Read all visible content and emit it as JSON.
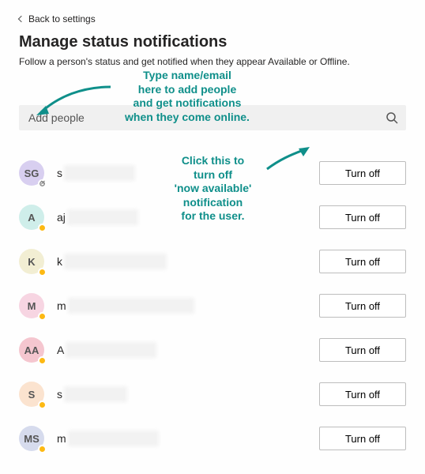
{
  "nav": {
    "back_label": "Back to settings"
  },
  "header": {
    "title": "Manage status notifications",
    "subtitle": "Follow a person's status and get notified when they appear Available or Offline."
  },
  "search": {
    "placeholder": "Add people"
  },
  "button_label": "Turn off",
  "people": [
    {
      "initials": "SG",
      "prefix": "s",
      "presence": "offline",
      "bg": "bg0",
      "redact_w": 90
    },
    {
      "initials": "A",
      "prefix": "aj",
      "presence": "away",
      "bg": "bg1",
      "redact_w": 90
    },
    {
      "initials": "K",
      "prefix": "k",
      "presence": "away",
      "bg": "bg2",
      "redact_w": 130
    },
    {
      "initials": "M",
      "prefix": "m",
      "presence": "away",
      "bg": "bg3",
      "redact_w": 160
    },
    {
      "initials": "AA",
      "prefix": "A",
      "presence": "away",
      "bg": "bg4",
      "redact_w": 115
    },
    {
      "initials": "S",
      "prefix": "s",
      "presence": "away",
      "bg": "bg5",
      "redact_w": 80
    },
    {
      "initials": "MS",
      "prefix": "m",
      "presence": "away",
      "bg": "bg6",
      "redact_w": 115
    }
  ],
  "annotations": {
    "add_people": "Type name/email\nhere to add people\nand get notifications\nwhen they come online.",
    "turn_off": "Click this to\nturn off\n'now available'\nnotification\nfor the user."
  },
  "colors": {
    "annotation": "#0f8f8a"
  }
}
